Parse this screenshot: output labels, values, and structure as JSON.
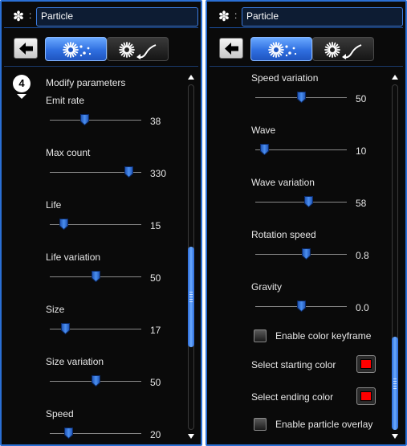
{
  "colors": {
    "accent": "#2a6fd4",
    "thumb": "#4a8ff0",
    "swatch_red": "#ff0000"
  },
  "left": {
    "title": "Particle",
    "title_colon": ":",
    "step_number": "4",
    "section_title": "Modify parameters",
    "params": [
      {
        "label": "Emit rate",
        "value": "38",
        "level": 0.38
      },
      {
        "label": "Max count",
        "value": "330",
        "level": 0.86
      },
      {
        "label": "Life",
        "value": "15",
        "level": 0.15
      },
      {
        "label": "Life variation",
        "value": "50",
        "level": 0.5
      },
      {
        "label": "Size",
        "value": "17",
        "level": 0.17
      },
      {
        "label": "Size variation",
        "value": "50",
        "level": 0.5
      },
      {
        "label": "Speed",
        "value": "20",
        "level": 0.2
      }
    ],
    "scroll": {
      "start": 0.47,
      "end": 0.76
    }
  },
  "right": {
    "title": "Particle",
    "title_colon": ":",
    "params": [
      {
        "label": "Speed variation",
        "value": "50",
        "level": 0.5
      },
      {
        "label": "Wave",
        "value": "10",
        "level": 0.1
      },
      {
        "label": "Wave variation",
        "value": "58",
        "level": 0.58
      },
      {
        "label": "Rotation speed",
        "value": "0.8",
        "level": 0.55
      },
      {
        "label": "Gravity",
        "value": "0.0",
        "level": 0.5
      }
    ],
    "enable_color_keyframe": "Enable color keyframe",
    "select_starting_color": "Select starting color",
    "select_ending_color": "Select ending color",
    "enable_particle_overlay": "Enable particle overlay",
    "scroll": {
      "start": 0.73,
      "end": 1.0
    }
  },
  "icons": {
    "title": "snowflake-icon",
    "back": "back-arrow-icon",
    "tab_emitter": "particle-emitter-icon",
    "tab_path": "particle-path-icon"
  }
}
